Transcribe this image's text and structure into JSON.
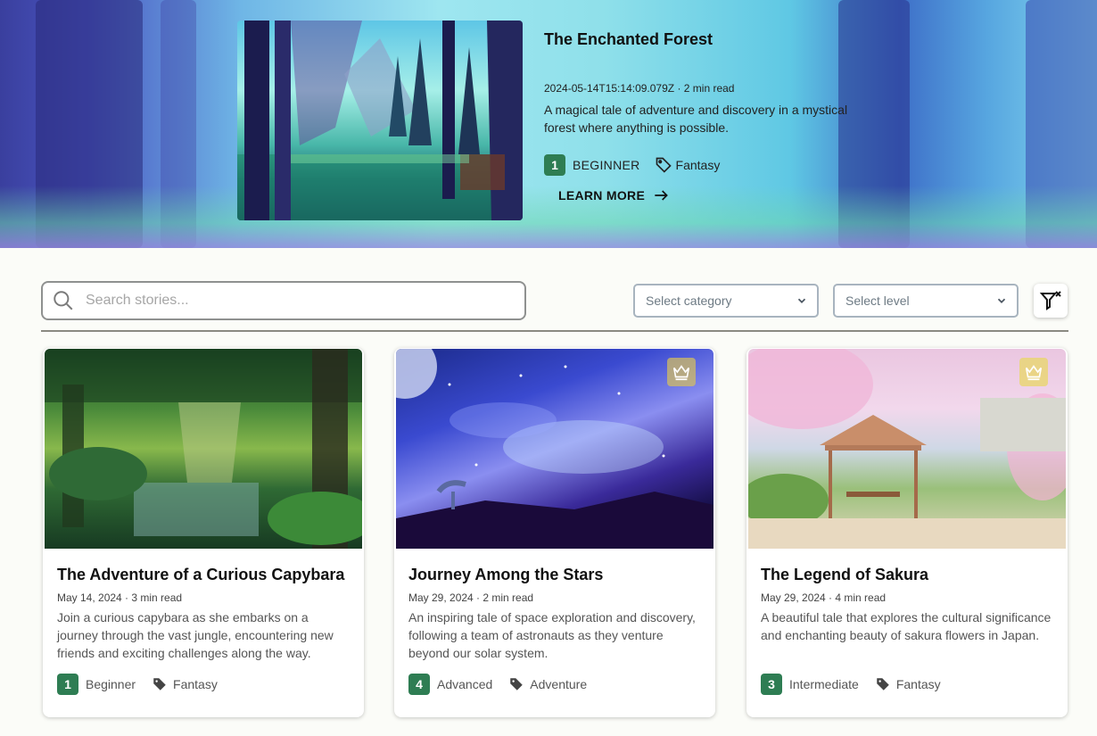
{
  "hero": {
    "title": "The Enchanted Forest",
    "meta": "2024-05-14T15:14:09.079Z · 2 min read",
    "description": "A magical tale of adventure and discovery in a mystical forest where anything is possible.",
    "level_number": "1",
    "level_label": "BEGINNER",
    "category": "Fantasy",
    "learn_more": "LEARN MORE",
    "image_icon": "forest-scene-image"
  },
  "filters": {
    "search_placeholder": "Search stories...",
    "category_placeholder": "Select category",
    "level_placeholder": "Select level",
    "clear_icon": "filter-clear-icon"
  },
  "colors": {
    "level_badge": "#2e7d53",
    "premium_badge": "#d9c25a",
    "page_bg": "#fbfcf8"
  },
  "stories": [
    {
      "title": "The Adventure of a Curious Capybara",
      "meta": "May 14, 2024 · 3 min read",
      "description": "Join a curious capybara as she embarks on a journey through the vast jungle, encountering new friends and exciting challenges along the way.",
      "level_number": "1",
      "level_label": "Beginner",
      "category": "Fantasy",
      "premium": false
    },
    {
      "title": "Journey Among the Stars",
      "meta": "May 29, 2024 · 2 min read",
      "description": "An inspiring tale of space exploration and discovery, following a team of astronauts as they venture beyond our solar system.",
      "level_number": "4",
      "level_label": "Advanced",
      "category": "Adventure",
      "premium": true
    },
    {
      "title": "The Legend of Sakura",
      "meta": "May 29, 2024 · 4 min read",
      "description": "A beautiful tale that explores the cultural significance and enchanting beauty of sakura flowers in Japan.",
      "level_number": "3",
      "level_label": "Intermediate",
      "category": "Fantasy",
      "premium": true
    }
  ]
}
